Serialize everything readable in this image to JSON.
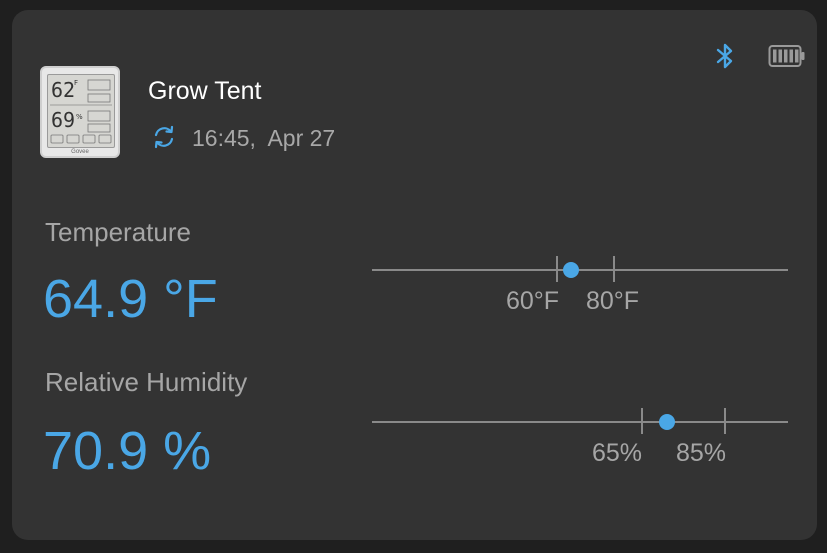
{
  "device": {
    "name": "Grow Tent",
    "sync_time": "16:45,  Apr 27",
    "thumb_brand": "Govee",
    "thumb_temp": "62",
    "thumb_hum": "69"
  },
  "status_icons": [
    "bluetooth-icon",
    "battery-icon"
  ],
  "temperature": {
    "label": "Temperature",
    "value_text": "64.9 °F",
    "value": 64.9,
    "low_label": "60°F",
    "high_label": "80°F",
    "low": 60,
    "high": 80
  },
  "humidity": {
    "label": "Relative Humidity",
    "value_text": "70.9 %",
    "value": 70.9,
    "low_label": "65%",
    "high_label": "85%",
    "low": 65,
    "high": 85
  },
  "colors": {
    "accent": "#4aa7e6",
    "card": "#333333",
    "background": "#1f1f1f",
    "muted_text": "#a6a6a6"
  }
}
